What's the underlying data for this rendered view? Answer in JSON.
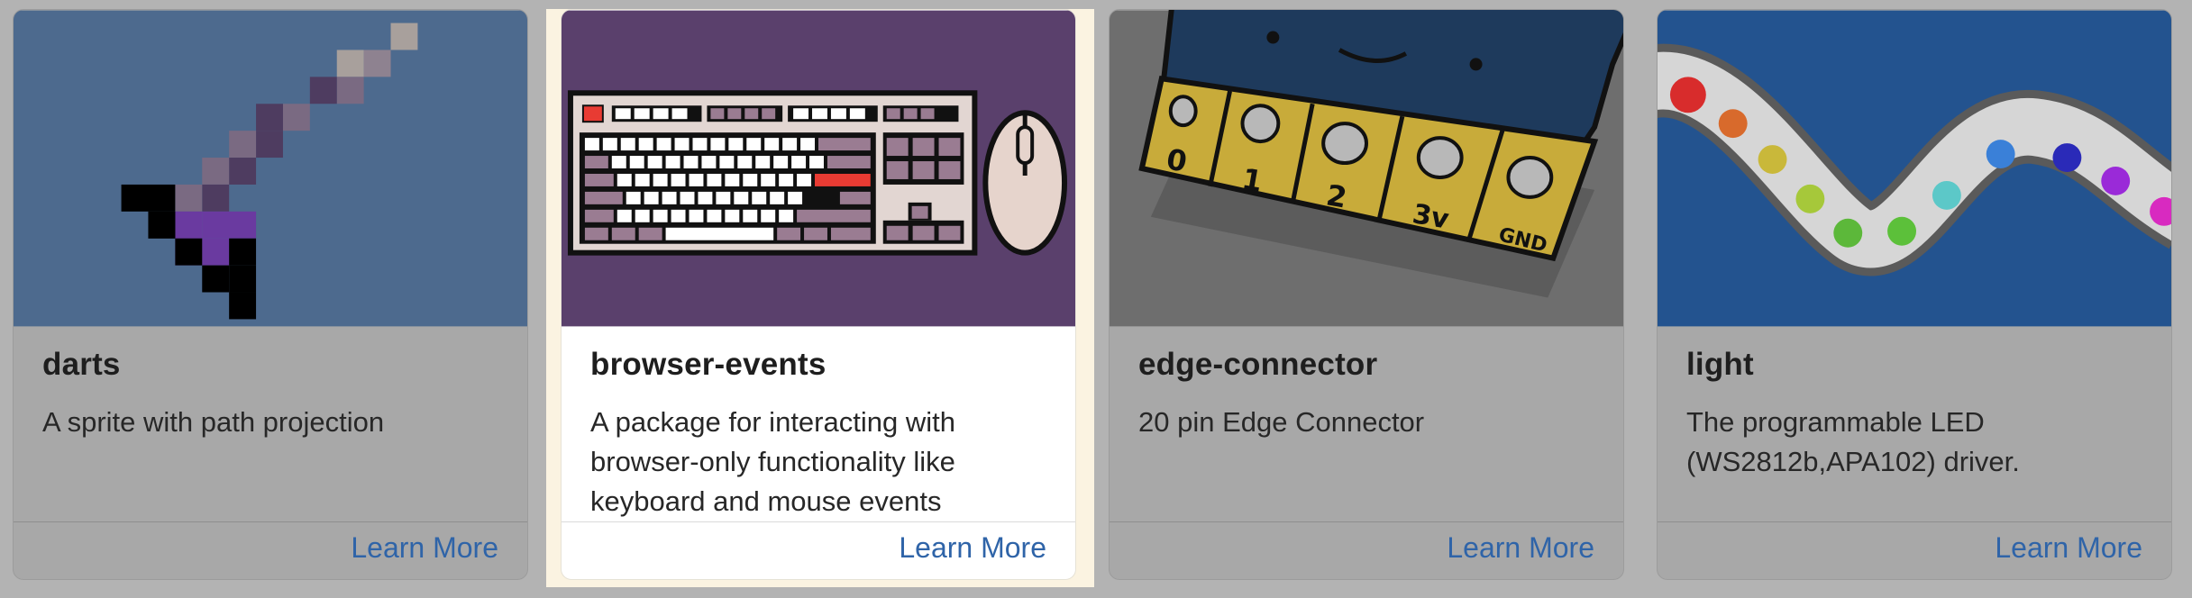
{
  "cards": [
    {
      "title": "darts",
      "description": "A sprite with path projection",
      "action": "Learn More"
    },
    {
      "title": "browser-events",
      "description": "A package for interacting with browser-only functionality like keyboard and mouse events",
      "action": "Learn More"
    },
    {
      "title": "edge-connector",
      "description": "20 pin Edge Connector",
      "action": "Learn More"
    },
    {
      "title": "light",
      "description": "The programmable LED (WS2812b,APA102) driver.",
      "action": "Learn More"
    }
  ],
  "edge_connector_pins": [
    "0",
    "1",
    "2",
    "3v",
    "GND"
  ],
  "colors": {
    "link": "#2f64a8",
    "highlight": "#fbf3e1"
  }
}
